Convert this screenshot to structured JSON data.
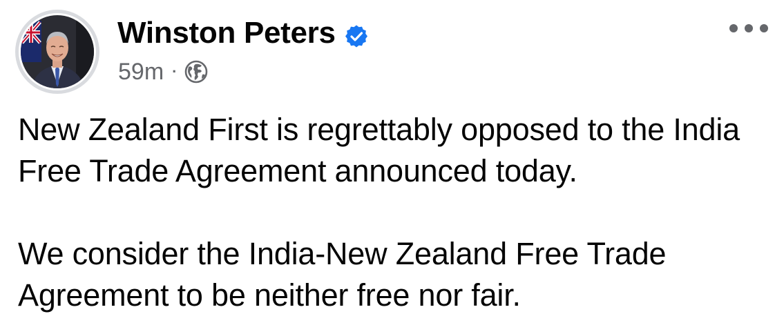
{
  "post": {
    "author": {
      "name": "Winston Peters",
      "verified": true,
      "avatar_icon": "profile-photo-icon"
    },
    "timestamp": "59m",
    "separator": "·",
    "audience_icon": "globe-icon",
    "more_icon": "more-options-icon",
    "paragraphs": [
      "New Zealand First is regrettably opposed to the India Free Trade Agreement announced today.",
      "We consider the India-New Zealand Free Trade Agreement to be neither free nor fair."
    ]
  },
  "colors": {
    "text_primary": "#050505",
    "text_secondary": "#65676b",
    "verified_blue": "#1877f2",
    "background": "#ffffff"
  }
}
